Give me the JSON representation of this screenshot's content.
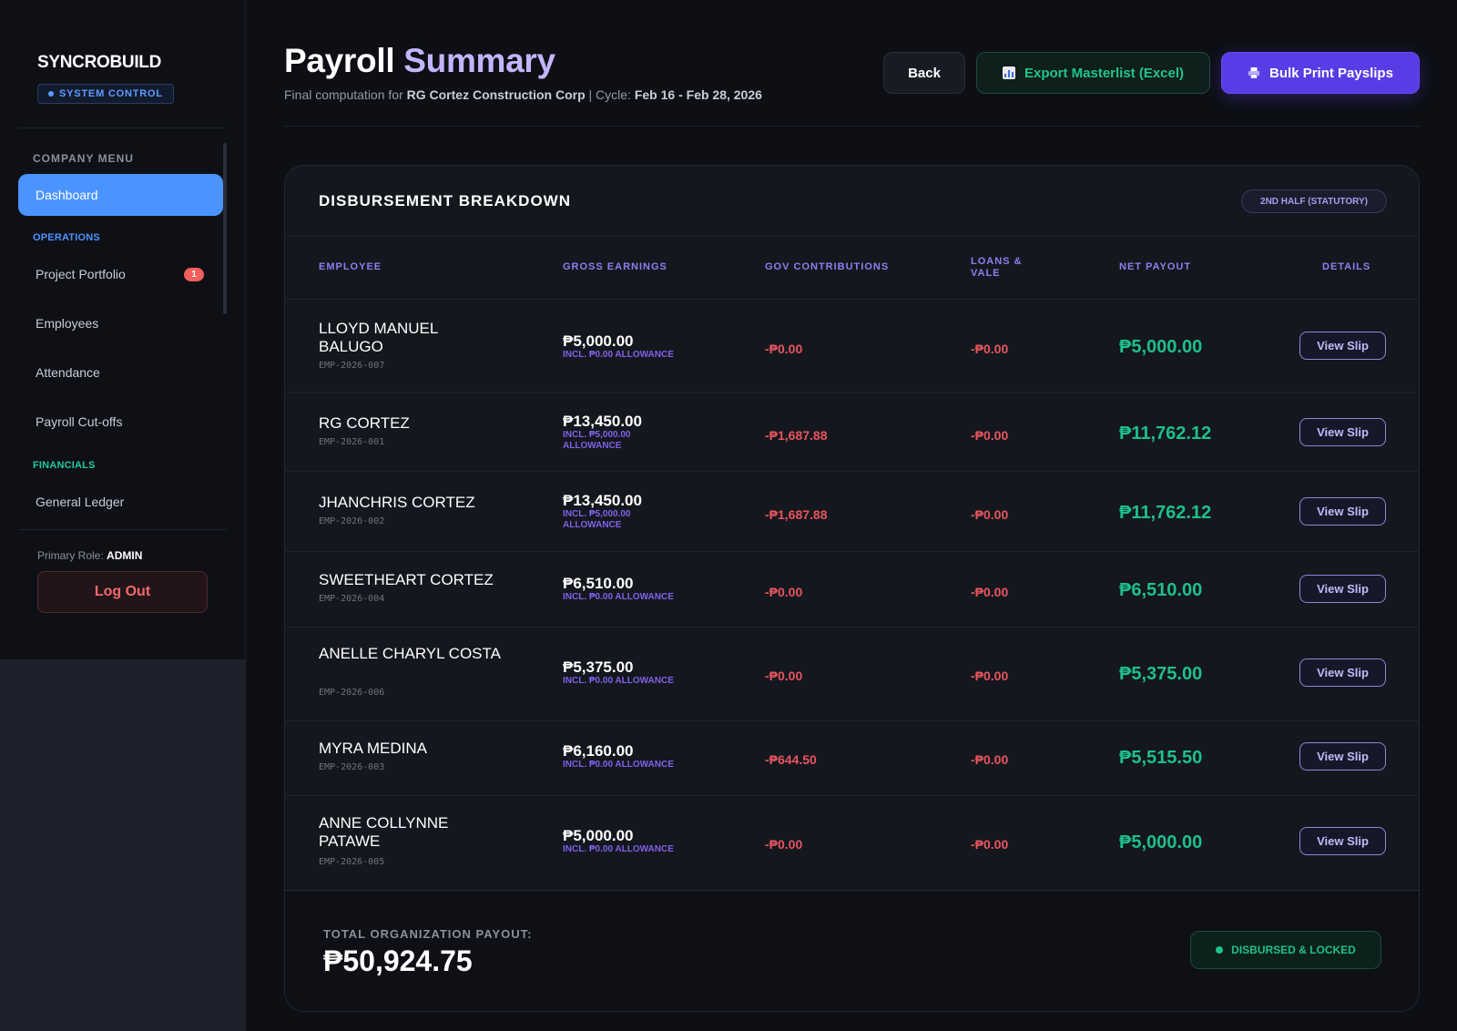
{
  "sidebar": {
    "brand": "SYNCROBUILD",
    "system_badge": "SYSTEM CONTROL",
    "menu_heading": "COMPANY MENU",
    "dashboard": "Dashboard",
    "operations_heading": "OPERATIONS",
    "operations_items": [
      "Project Portfolio",
      "Employees",
      "Attendance",
      "Payroll Cut-offs"
    ],
    "project_portfolio_badge": "1",
    "financials_heading": "FINANCIALS",
    "financials_items": [
      "General Ledger"
    ],
    "role_label": "Primary Role:",
    "role_value": "ADMIN",
    "logout": "Log Out"
  },
  "header": {
    "title_part1": "Payroll",
    "title_part2": "Summary",
    "subtitle_prefix": "Final computation for",
    "company": "RG Cortez Construction Corp",
    "cycle_prefix": "| Cycle:",
    "cycle": "Feb 16 - Feb 28, 2026",
    "back_label": "Back",
    "export_label": "Export Masterlist (Excel)",
    "print_label": "Bulk Print Payslips"
  },
  "card": {
    "title": "DISBURSEMENT BREAKDOWN",
    "half_badge": "2ND HALF (STATUTORY)",
    "columns": [
      "EMPLOYEE",
      "GROSS EARNINGS",
      "GOV CONTRIBUTIONS",
      "LOANS & VALE",
      "NET PAYOUT",
      "DETAILS"
    ],
    "rows": [
      {
        "name": "LLOYD MANUEL BALUGO",
        "id": "EMP-2026-007",
        "gross": "₱5,000.00",
        "allowance": "INCL. ₱0.00 ALLOWANCE",
        "gov": "-₱0.00",
        "loans": "-₱0.00",
        "net": "₱5,000.00",
        "action": "View Slip"
      },
      {
        "name": "RG CORTEZ",
        "id": "EMP-2026-001",
        "gross": "₱13,450.00",
        "allowance": "INCL. ₱5,000.00 ALLOWANCE",
        "gov": "-₱1,687.88",
        "loans": "-₱0.00",
        "net": "₱11,762.12",
        "action": "View Slip"
      },
      {
        "name": "JHANCHRIS CORTEZ",
        "id": "EMP-2026-002",
        "gross": "₱13,450.00",
        "allowance": "INCL. ₱5,000.00 ALLOWANCE",
        "gov": "-₱1,687.88",
        "loans": "-₱0.00",
        "net": "₱11,762.12",
        "action": "View Slip"
      },
      {
        "name": "SWEETHEART CORTEZ",
        "id": "EMP-2026-004",
        "gross": "₱6,510.00",
        "allowance": "INCL. ₱0.00 ALLOWANCE",
        "gov": "-₱0.00",
        "loans": "-₱0.00",
        "net": "₱6,510.00",
        "action": "View Slip"
      },
      {
        "name": "ANELLE CHARYL COSTA",
        "id": "EMP-2026-006",
        "gross": "₱5,375.00",
        "allowance": "INCL. ₱0.00 ALLOWANCE",
        "gov": "-₱0.00",
        "loans": "-₱0.00",
        "net": "₱5,375.00",
        "action": "View Slip"
      },
      {
        "name": "MYRA MEDINA",
        "id": "EMP-2026-003",
        "gross": "₱6,160.00",
        "allowance": "INCL. ₱0.00 ALLOWANCE",
        "gov": "-₱644.50",
        "loans": "-₱0.00",
        "net": "₱5,515.50",
        "action": "View Slip"
      },
      {
        "name": "ANNE COLLYNNE PATAWE",
        "id": "EMP-2026-005",
        "gross": "₱5,000.00",
        "allowance": "INCL. ₱0.00 ALLOWANCE",
        "gov": "-₱0.00",
        "loans": "-₱0.00",
        "net": "₱5,000.00",
        "action": "View Slip"
      }
    ],
    "total_label": "TOTAL ORGANIZATION PAYOUT:",
    "total_value": "₱50,924.75",
    "status": "DISBURSED & LOCKED"
  },
  "colors": {
    "accent_blue": "#4b94ff",
    "accent_purple": "#5a3ce6",
    "positive_green": "#1fbf8b",
    "negative_red": "#e8555e"
  },
  "icons": {
    "export": "chart-icon",
    "print": "printer-icon"
  }
}
